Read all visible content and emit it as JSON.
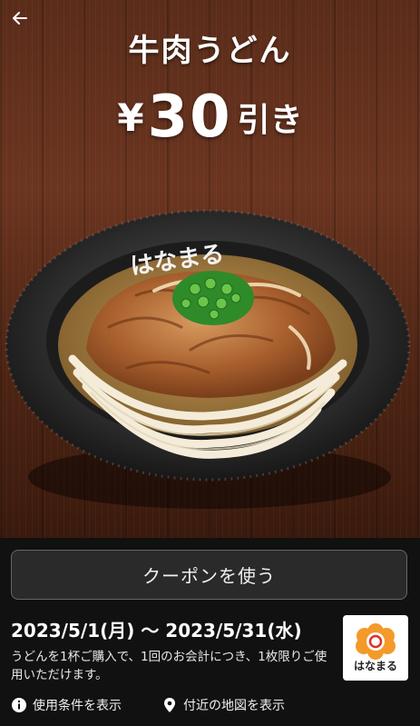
{
  "hero": {
    "title": "牛肉うどん",
    "discount_currency": "¥",
    "discount_amount": "30",
    "discount_suffix": "引き",
    "bowl_brand": "はなまる"
  },
  "coupon": {
    "use_button_label": "クーポンを使う",
    "period": "2023/5/1(月) 〜 2023/5/31(水)",
    "description": "うどんを1杯ご購入で、1回のお会計につき、1枚限りご使用いただけます。"
  },
  "brand_logo": {
    "text": "はなまる"
  },
  "links": {
    "terms_label": "使用条件を表示",
    "map_label": "付近の地図を表示"
  },
  "icons": {
    "back": "arrow-left-icon",
    "info": "info-icon",
    "location": "location-pin-icon"
  },
  "colors": {
    "background": "#111111",
    "logo_orange": "#f39a2a"
  }
}
